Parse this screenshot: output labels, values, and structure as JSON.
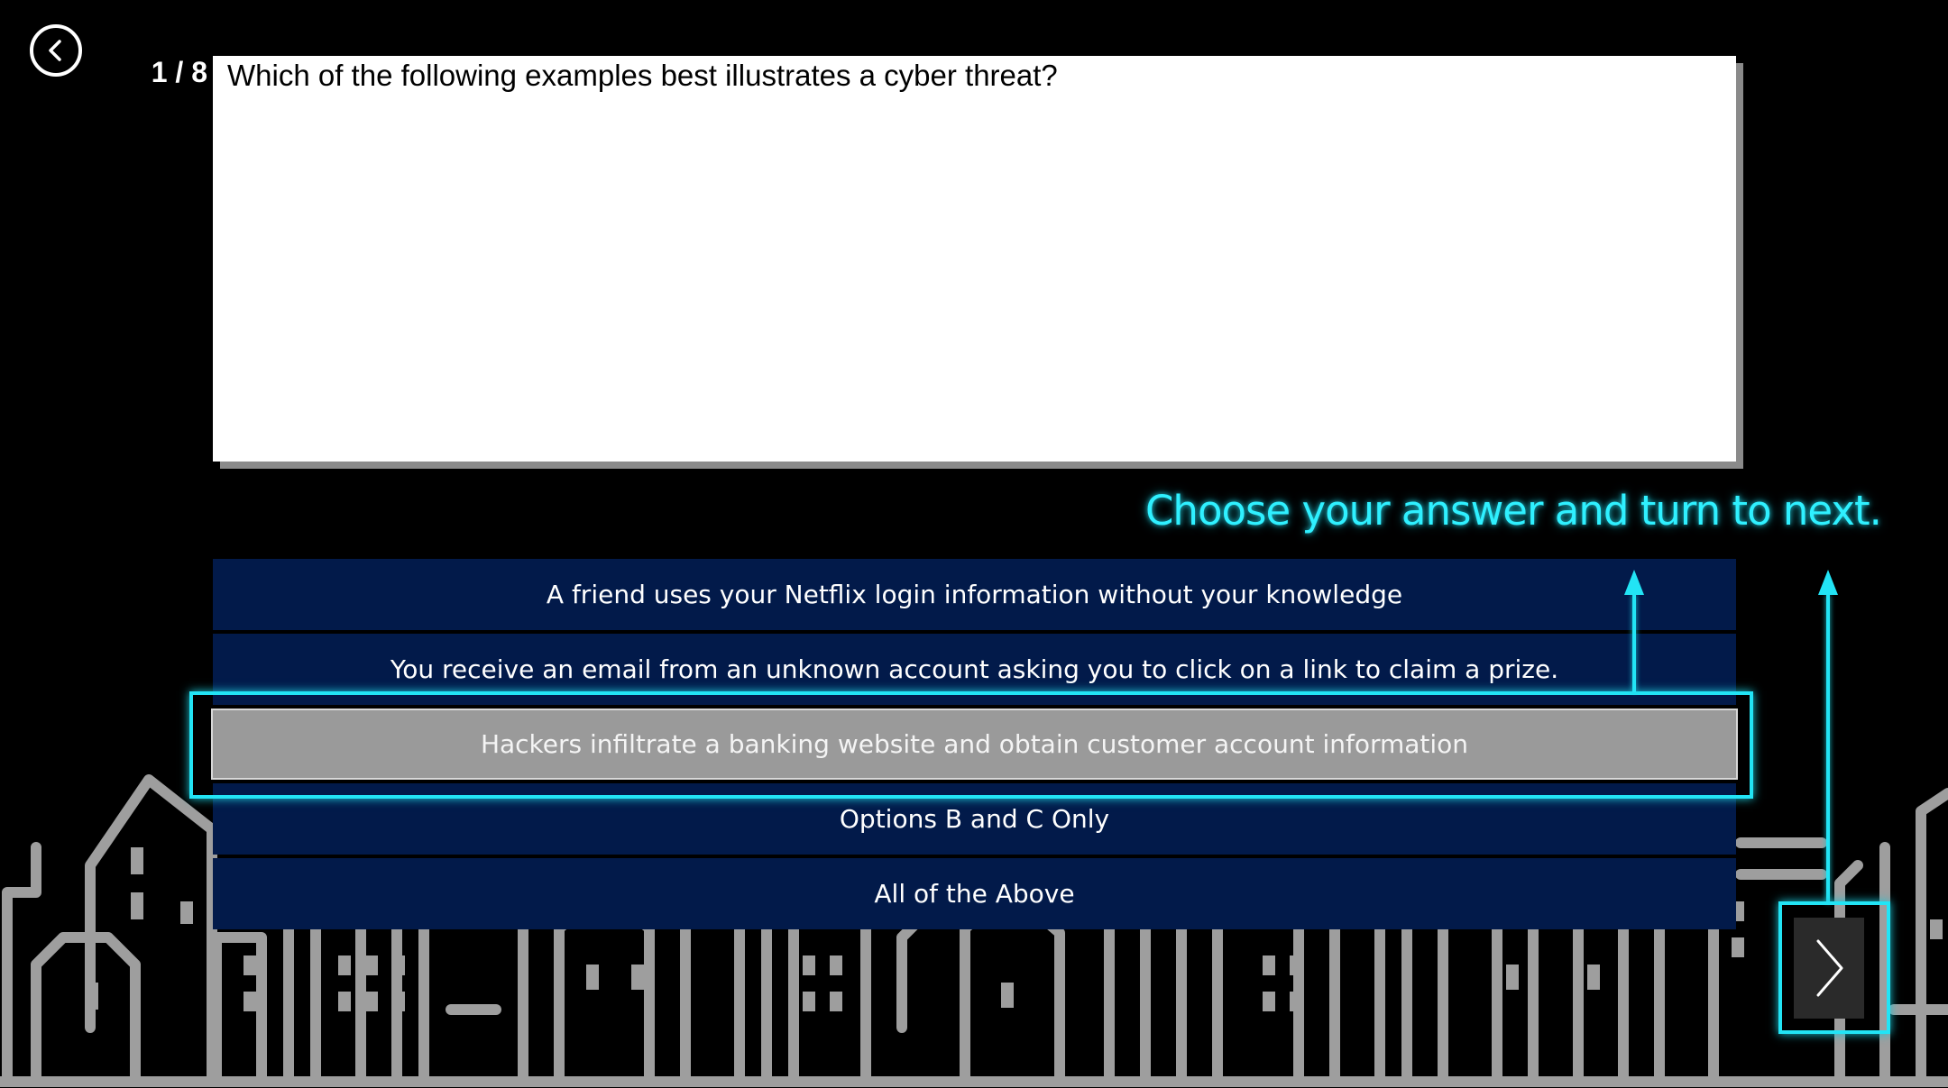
{
  "quiz": {
    "counter": "1 / 8",
    "question": "Which of the following examples best illustrates a cyber threat?",
    "instruction": "Choose your answer and turn to next.",
    "options": [
      {
        "label": "A friend uses your Netflix login information without your knowledge"
      },
      {
        "label": "You receive an email from an unknown account asking you to click on a link to claim a prize."
      },
      {
        "label": "Hackers infiltrate a banking website and obtain customer account information"
      },
      {
        "label": "Options B and C Only"
      },
      {
        "label": "All of the Above"
      }
    ],
    "selected_index": 2
  },
  "icons": {
    "back": "chevron-left-circle-icon",
    "next": "chevron-right-icon"
  },
  "colors": {
    "accent": "#22e4f5",
    "option_bg": "#021a4a",
    "selected_bg": "#9a9a9a",
    "skyline": "#9e9e9e"
  }
}
